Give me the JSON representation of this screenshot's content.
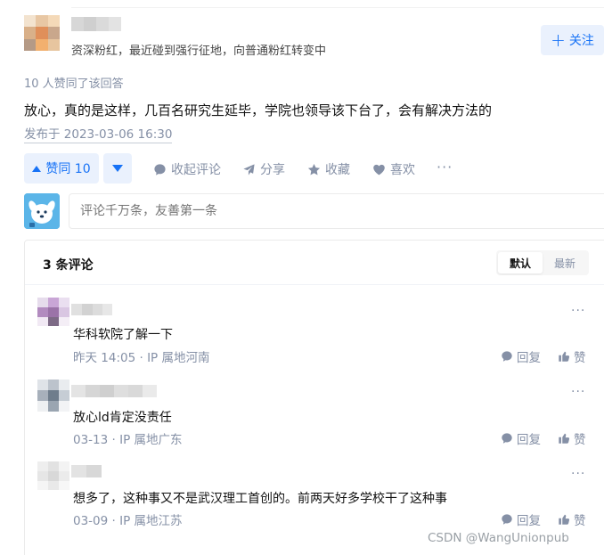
{
  "author": {
    "bio": "资深粉红，最近碰到强行征地，向普通粉红转变中",
    "follow_label": "关注"
  },
  "answer": {
    "agree_count_text": "10 人赞同了该回答",
    "content": "放心，真的是这样，几百名研究生延毕，学院也领导该下台了，会有解决方法的",
    "published": "发布于 2023-03-06 16:30"
  },
  "actions": {
    "upvote_label": "赞同 10",
    "collapse_comments": "收起评论",
    "share": "分享",
    "favorite": "收藏",
    "like": "喜欢",
    "more": "···"
  },
  "comment_input": {
    "placeholder": "评论千万条，友善第一条"
  },
  "comments_panel": {
    "title": "3 条评论",
    "sort_default": "默认",
    "sort_latest": "最新",
    "reply_label": "回复",
    "like_label": "赞",
    "more": "···",
    "items": [
      {
        "text": "华科软院了解一下",
        "meta": "昨天 14:05 · IP 属地河南"
      },
      {
        "text": "放心ld肯定没责任",
        "meta": "03-13 · IP 属地广东"
      },
      {
        "text": "想多了，这种事又不是武汉理工首创的。前两天好多学校干了这种事",
        "meta": "03-09 · IP 属地江苏"
      }
    ]
  },
  "watermark": "CSDN @WangUnionpub",
  "colors": {
    "accent": "#1772f6",
    "accent_bg": "#eaf1fd",
    "muted": "#8590a6"
  },
  "icons": [
    "plus-icon",
    "upvote-arrow-icon",
    "downvote-arrow-icon",
    "comment-icon",
    "share-icon",
    "star-icon",
    "heart-icon",
    "reply-icon",
    "thumb-up-icon",
    "more-icon"
  ]
}
